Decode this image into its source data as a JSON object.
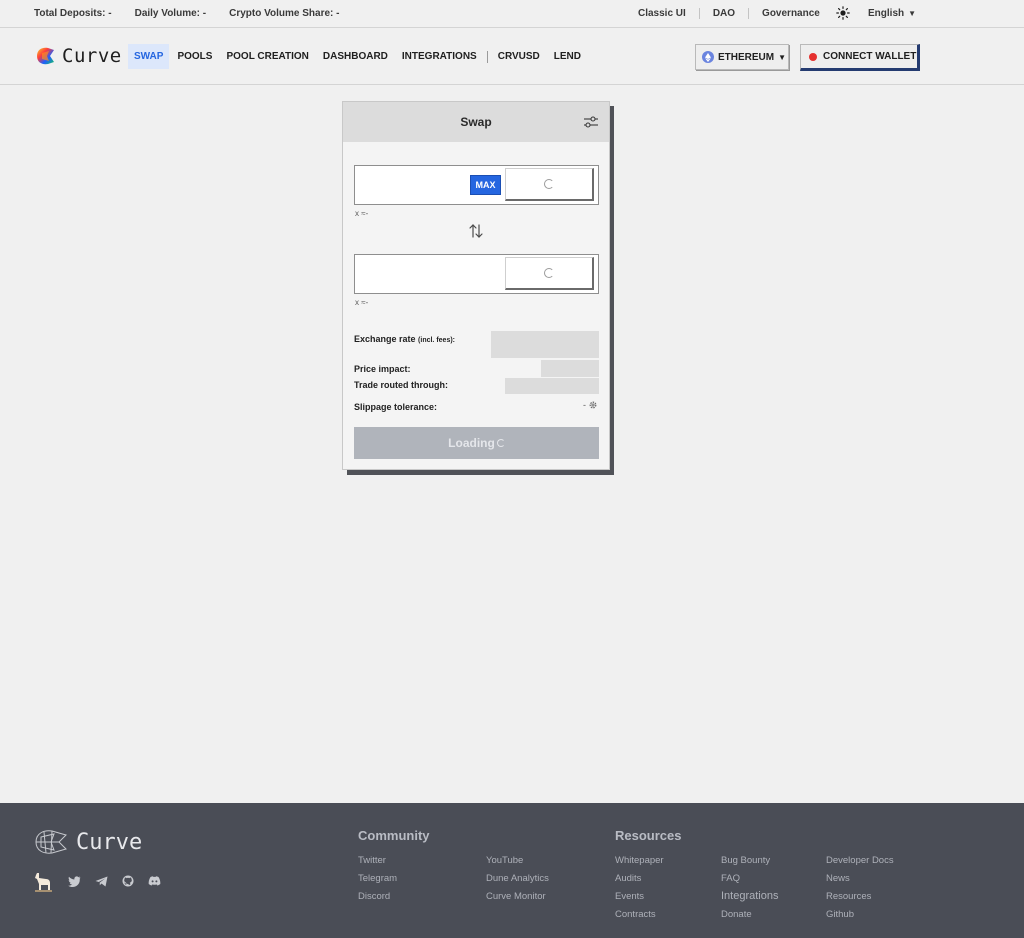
{
  "stats": {
    "total_deposits": "Total Deposits: -",
    "daily_volume": "Daily Volume: -",
    "crypto_volume_share": "Crypto Volume Share: -"
  },
  "top_links": {
    "classic_ui": "Classic UI",
    "dao": "DAO",
    "governance": "Governance",
    "language": "English"
  },
  "header": {
    "logo_text": "Curve",
    "nav": [
      "SWAP",
      "POOLS",
      "POOL CREATION",
      "DASHBOARD",
      "INTEGRATIONS",
      "CRVUSD",
      "LEND"
    ],
    "network_label": "ETHEREUM",
    "connect_label": "CONNECT WALLET"
  },
  "swap": {
    "title": "Swap",
    "max_label": "MAX",
    "from_approx": "x ≈-",
    "to_approx": "x ≈-",
    "swap_icon": "swap-arrows-icon",
    "exchange_rate_label": "Exchange rate",
    "exchange_rate_note": "(incl. fees):",
    "price_impact_label": "Price impact:",
    "routed_label": "Trade routed through:",
    "slippage_label": "Slippage tolerance:",
    "slippage_value": "-",
    "loading_label": "Loading"
  },
  "footer": {
    "logo_text": "Curve",
    "community_title": "Community",
    "community_links": [
      "Twitter",
      "Telegram",
      "Discord",
      "YouTube",
      "Dune Analytics",
      "Curve Monitor"
    ],
    "resources_title": "Resources",
    "resources_links": [
      "Whitepaper",
      "Audits",
      "Events",
      "Contracts",
      "Bug Bounty",
      "FAQ",
      "Integrations",
      "Donate",
      "Developer Docs",
      "News",
      "Resources",
      "Github"
    ]
  },
  "colors": {
    "accent": "#2566e0",
    "wallet_border": "#243b70",
    "status_dot": "#e5302e",
    "footer_bg": "#4a4d56"
  }
}
